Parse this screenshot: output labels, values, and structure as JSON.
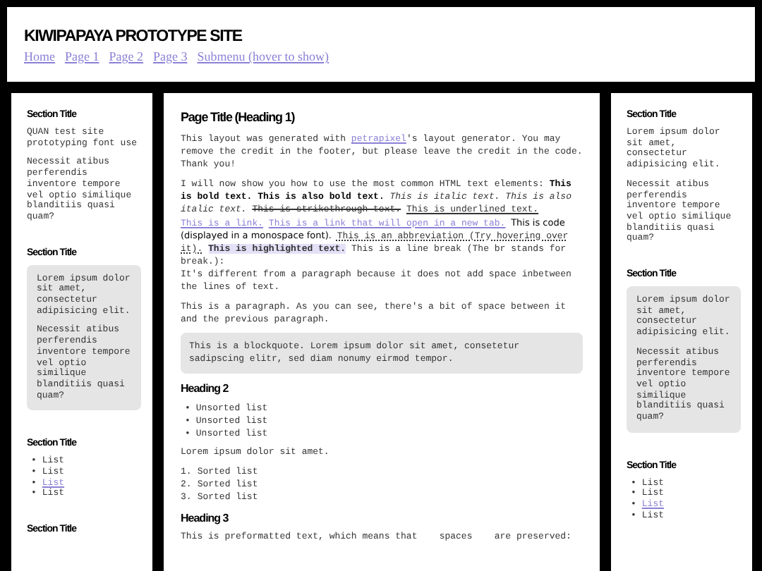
{
  "header": {
    "title": "KIWIPAPAYA PROTOTYPE SITE",
    "nav": [
      "Home",
      "Page 1",
      "Page 2",
      "Page 3",
      "Submenu (hover to show)"
    ]
  },
  "left_sidebar": [
    {
      "title": "Section Title",
      "kind": "text",
      "paragraphs": [
        "QUAN test site prototyping font use",
        "Necessit atibus perferendis inventore tempore vel optio similique blanditiis quasi quam?"
      ]
    },
    {
      "title": "Section Title",
      "kind": "box",
      "paragraphs": [
        "Lorem ipsum dolor sit amet, consectetur adipisicing elit.",
        "Necessit atibus perferendis inventore tempore vel optio similique blanditiis quasi quam?"
      ]
    },
    {
      "title": "Section Title",
      "kind": "list",
      "items": [
        {
          "bullet": "•",
          "text": "List",
          "link": false
        },
        {
          "bullet": "•",
          "text": "List",
          "link": false
        },
        {
          "bullet": "•",
          "text": "List",
          "link": true
        },
        {
          "bullet": "•",
          "text": "List",
          "link": false
        }
      ]
    },
    {
      "title": "Section Title",
      "kind": "text"
    }
  ],
  "main": [
    {
      "kind": "h1",
      "text": "Page Title (Heading 1)"
    },
    {
      "kind": "p",
      "segments": [
        {
          "kind": "text",
          "text": "This layout was generated with "
        },
        {
          "kind": "link",
          "text": "petrapixel"
        },
        {
          "kind": "text",
          "text": "'s layout generator. You may remove the credit in the footer, but please leave the credit in the code. Thank you!"
        }
      ]
    },
    {
      "kind": "p",
      "segments": [
        {
          "kind": "text",
          "text": "I will now show you how to use the most common HTML text elements: "
        },
        {
          "kind": "bold",
          "text": "This is bold text."
        },
        {
          "kind": "bold",
          "text": "This is also bold text."
        },
        {
          "kind": "italic",
          "text": "This is italic text."
        },
        {
          "kind": "italic",
          "text": "This is also italic text."
        },
        {
          "kind": "strike",
          "text": "This is strikethrough text."
        },
        {
          "kind": "underline",
          "text": "This is underlined text."
        },
        {
          "kind": "link",
          "text": "This is a link."
        },
        {
          "kind": "link",
          "text": "This is a link that will open in a new tab."
        },
        {
          "kind": "code",
          "text": "This is code (displayed in a monospace font)."
        },
        {
          "kind": "abbr",
          "text": "This is an abbreviation (Try hovering over it)."
        },
        {
          "kind": "highlight",
          "text": "This is highlighted text."
        },
        {
          "kind": "text",
          "text": " This is a line break (The br stands for break.):"
        },
        {
          "kind": "br"
        },
        {
          "kind": "text",
          "text": "It's different from a paragraph because it does not add space inbetween the lines of text."
        }
      ]
    },
    {
      "kind": "p",
      "segments": [
        {
          "kind": "text",
          "text": "This is a paragraph. As you can see, there's a bit of space between it and the previous paragraph."
        }
      ]
    },
    {
      "kind": "blockquote",
      "text": "This is a blockquote. Lorem ipsum dolor sit amet, consetetur sadipscing elitr, sed diam nonumy eirmod tempor."
    },
    {
      "kind": "h2",
      "text": "Heading 2"
    },
    {
      "kind": "ul",
      "items": [
        {
          "bullet": "•",
          "text": "Unsorted list"
        },
        {
          "bullet": "•",
          "text": "Unsorted list"
        },
        {
          "bullet": "•",
          "text": "Unsorted list"
        }
      ]
    },
    {
      "kind": "p",
      "segments": [
        {
          "kind": "text",
          "text": "Lorem ipsum dolor sit amet."
        }
      ]
    },
    {
      "kind": "ol",
      "items": [
        {
          "number": "1.",
          "text": "Sorted list"
        },
        {
          "number": "2.",
          "text": "Sorted list"
        },
        {
          "number": "3.",
          "text": "Sorted list"
        }
      ]
    },
    {
      "kind": "h3",
      "text": "Heading 3"
    },
    {
      "kind": "pre",
      "text": "This is preformatted text, which means that    spaces    are preserved:"
    }
  ],
  "right_sidebar": [
    {
      "title": "Section Title",
      "kind": "text",
      "paragraphs": [
        "Lorem ipsum dolor sit amet, consectetur adipisicing elit.",
        "Necessit atibus perferendis inventore tempore vel optio similique blanditiis quasi quam?"
      ]
    },
    {
      "title": "Section Title",
      "kind": "box",
      "paragraphs": [
        "Lorem ipsum dolor sit amet, consectetur adipisicing elit.",
        "Necessit atibus perferendis inventore tempore vel optio similique blanditiis quasi quam?"
      ]
    },
    {
      "title": "Section Title",
      "kind": "list",
      "items": [
        {
          "bullet": "•",
          "text": "List",
          "link": false
        },
        {
          "bullet": "•",
          "text": "List",
          "link": false
        },
        {
          "bullet": "•",
          "text": "List",
          "link": true
        },
        {
          "bullet": "•",
          "text": "List",
          "link": false
        }
      ]
    }
  ]
}
